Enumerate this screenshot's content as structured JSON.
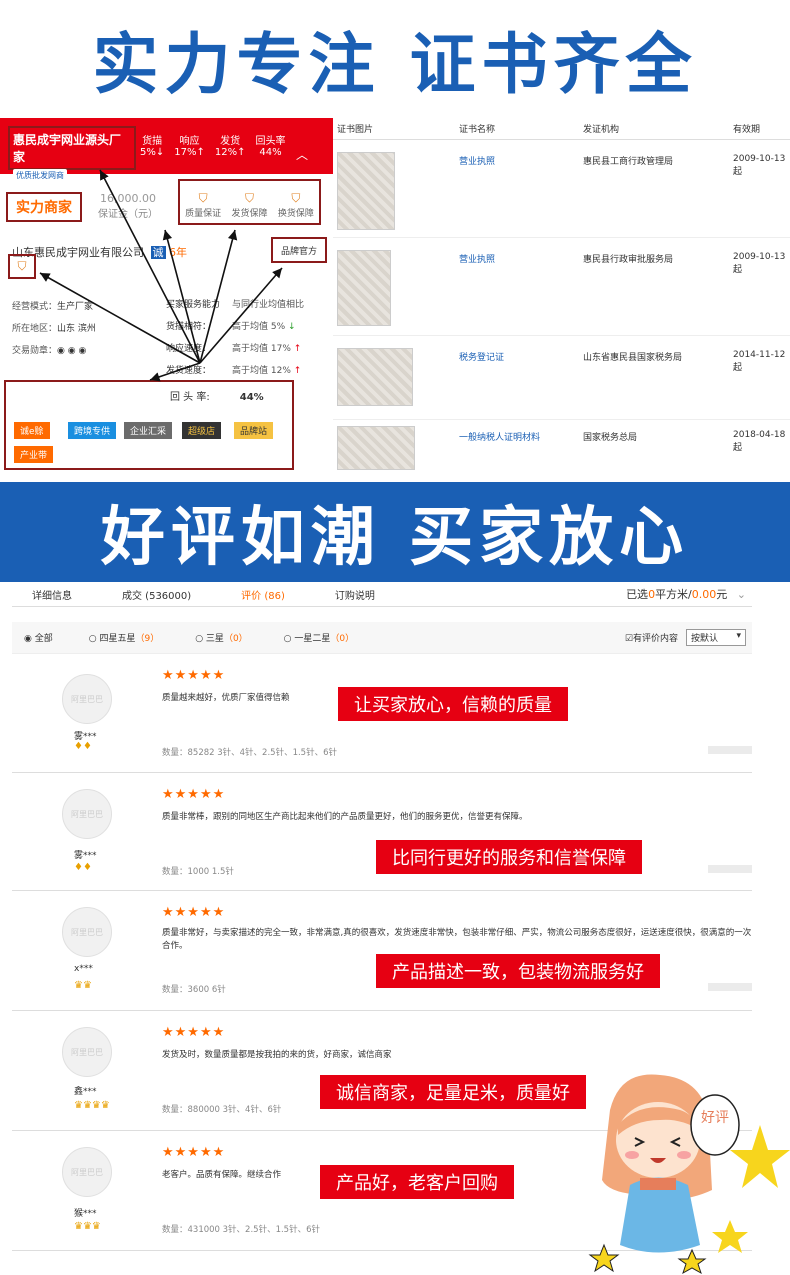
{
  "banner_top": "实力专注 证书齐全",
  "banner_mid": "好评如潮 买家放心",
  "supplier": {
    "name": "惠民成宇网业源头厂家",
    "badge": "优质批发网商",
    "stats": [
      {
        "label": "货描",
        "value": "5%↓"
      },
      {
        "label": "响应",
        "value": "17%↑"
      },
      {
        "label": "发货",
        "value": "12%↑"
      },
      {
        "label": "回头率",
        "value": "44%"
      }
    ],
    "strength_badge": "实力商家",
    "deposit_amount": "16,000.00",
    "deposit_label": "保证金（元）",
    "guarantees": [
      "质量保证",
      "发货保障",
      "换货保障"
    ],
    "company": "山东惠民成宇网业有限公司",
    "years_badge": "诚",
    "years": "6年",
    "brand_official": "品牌官方",
    "info": [
      {
        "label": "经营模式：",
        "value": "生产厂家"
      },
      {
        "label": "所在地区：",
        "value": "山东 滨州"
      },
      {
        "label": "交易勋章：",
        "value": "◉ ◉ ◉"
      }
    ],
    "service_title": "买家服务能力",
    "service_compare": "与同行业均值相比",
    "service_rows": [
      {
        "label": "货描相符：",
        "value": "高于均值 5%",
        "dir": "↓",
        "color": "g"
      },
      {
        "label": "响应速度：",
        "value": "高于均值 17%",
        "dir": "↑",
        "color": "r"
      },
      {
        "label": "发货速度：",
        "value": "高于均值 12%",
        "dir": "↑",
        "color": "r"
      }
    ],
    "repeat_label": "回 头 率:",
    "repeat_value": "44%",
    "tags": [
      "诚e赊",
      "跨境专供",
      "企业汇采",
      "超级店",
      "品牌站",
      "产业带"
    ],
    "colors": {
      "red": "#e60012",
      "orange": "#ff6a00",
      "blue": "#1a5fb4",
      "dark_red_box": "#8b1a1a"
    }
  },
  "cert_table": {
    "headers": [
      "证书图片",
      "证书名称",
      "发证机构",
      "有效期"
    ],
    "rows": [
      {
        "name": "营业执照",
        "org": "惠民县工商行政管理局",
        "date": "2009-10-13 起"
      },
      {
        "name": "营业执照",
        "org": "惠民县行政审批服务局",
        "date": "2009-10-13 起"
      },
      {
        "name": "税务登记证",
        "org": "山东省惠民县国家税务局",
        "date": "2014-11-12 起"
      },
      {
        "name": "一般纳税人证明材料",
        "org": "国家税务总局",
        "date": "2018-04-18 起"
      }
    ]
  },
  "reviews_tabs": {
    "tabs": [
      "详细信息",
      "成交 (536000)",
      "评价 (86)",
      "订购说明"
    ],
    "selected_prefix": "已选",
    "selected_value": "0",
    "selected_unit": "平方米/",
    "selected_price": "0.00",
    "selected_suffix": "元"
  },
  "filter": {
    "options": [
      {
        "label": "全部",
        "count": ""
      },
      {
        "label": "四星五星",
        "count": "（9）"
      },
      {
        "label": "三星",
        "count": "（0）"
      },
      {
        "label": "一星二星",
        "count": "（0）"
      }
    ],
    "has_content": "有评价内容",
    "sort": "按默认"
  },
  "reviews": [
    {
      "user": "雾***",
      "level": "♦♦",
      "stars": "★★★★★",
      "text": "质量越来越好，优质厂家值得信赖",
      "qty": "数量：85282   3针、4针、2.5针、1.5针、6针",
      "callout": "让买家放心，信赖的质量"
    },
    {
      "user": "雾***",
      "level": "♦♦",
      "stars": "★★★★★",
      "text": "质量非常棒，跟别的同地区生产商比起来他们的产品质量更好，他们的服务更优，信誉更有保障。",
      "qty": "数量：1000   1.5针",
      "callout": "比同行更好的服务和信誉保障"
    },
    {
      "user": "x***",
      "level": "♛♛",
      "stars": "★★★★★",
      "text": "质量非常好，与卖家描述的完全一致，非常满意,真的很喜欢，发货速度非常快，包装非常仔细、严实，物流公司服务态度很好，运送速度很快，很满意的一次合作。",
      "qty": "数量：3600   6针",
      "callout": "产品描述一致，包装物流服务好"
    },
    {
      "user": "鑫***",
      "level": "♛♛♛♛",
      "stars": "★★★★★",
      "text": "发货及时，数量质量都是按我拍的来的货，好商家，诚信商家",
      "qty": "数量：880000   3针、4针、6针",
      "callout": "诚信商家，足量足米，质量好"
    },
    {
      "user": "猴***",
      "level": "♛♛♛",
      "stars": "★★★★★",
      "text": "老客户。品质有保障。继续合作",
      "qty": "数量：431000   3针、2.5针、1.5针、6针",
      "callout": "产品好，老客户回购"
    }
  ],
  "avatar_text": "阿里巴巴",
  "cartoon_text": "好评"
}
